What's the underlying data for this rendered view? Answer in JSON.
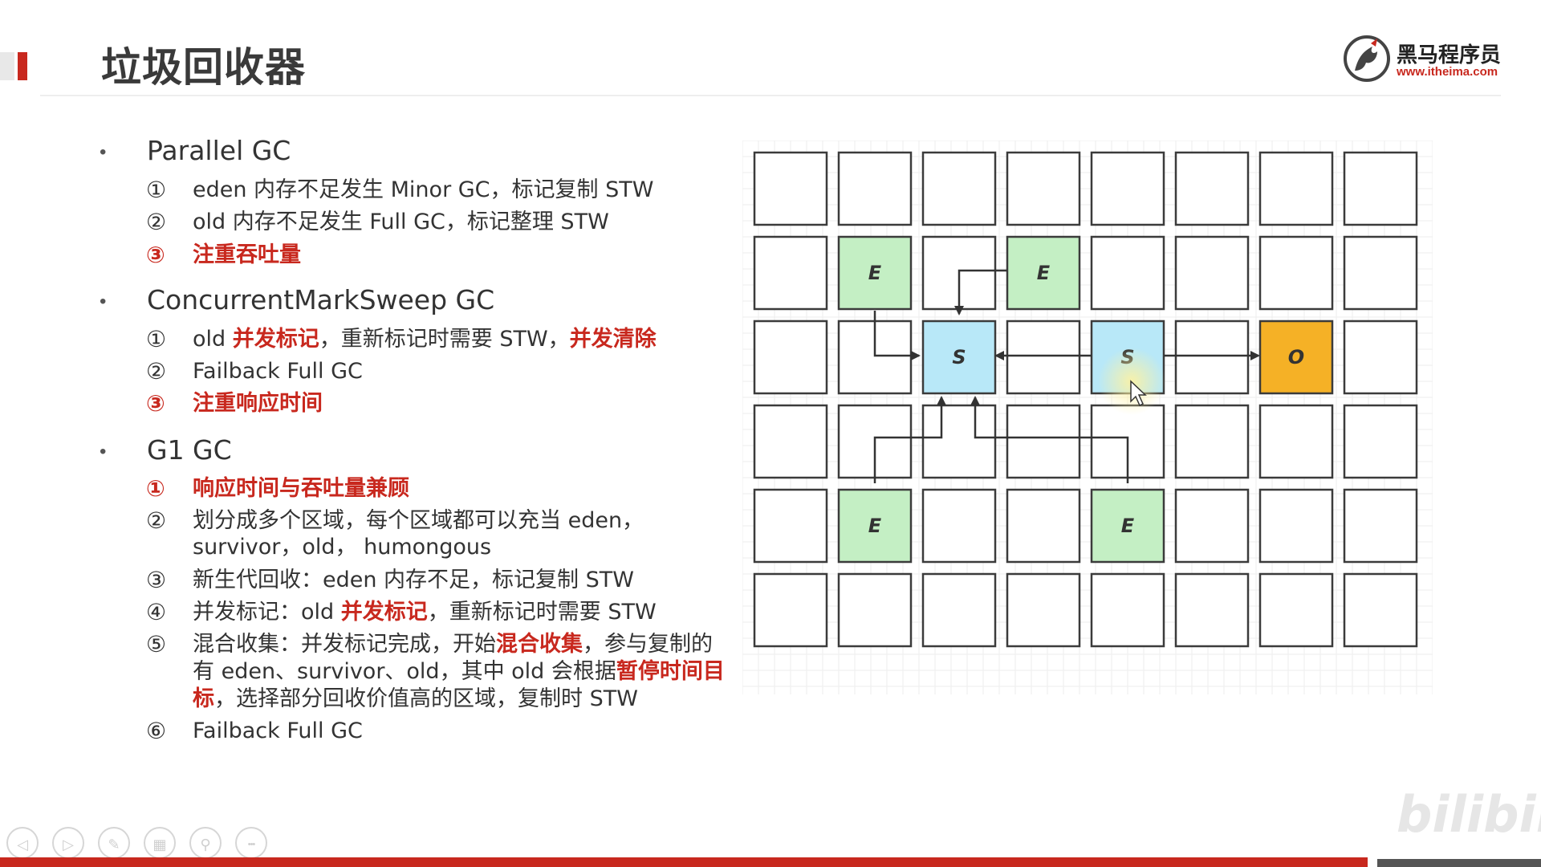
{
  "slide": {
    "title": "垃圾回收器",
    "logo": {
      "name": "黑马程序员",
      "url": "www.itheima.com"
    },
    "watermark": "bilibili"
  },
  "sections": [
    {
      "heading": "Parallel GC",
      "items": [
        {
          "num": "①",
          "text": "eden 内存不足发生 Minor GC，标记复制 STW"
        },
        {
          "num": "②",
          "text": "old 内存不足发生 Full GC，标记整理 STW"
        },
        {
          "num": "③",
          "text": "注重吞吐量"
        }
      ]
    },
    {
      "heading": "ConcurrentMarkSweep GC",
      "items": [
        {
          "num": "①",
          "parts": [
            "old ",
            "并发标记",
            "，重新标记时需要 STW，",
            "并发清除"
          ]
        },
        {
          "num": "②",
          "text": "Failback Full GC"
        },
        {
          "num": "③",
          "text": "注重响应时间"
        }
      ]
    },
    {
      "heading": "G1 GC",
      "items": [
        {
          "num": "①",
          "text": "响应时间与吞吐量兼顾"
        },
        {
          "num": "②",
          "lines": [
            "划分成多个区域，每个区域都可以充当 eden，",
            "survivor，old， humongous"
          ]
        },
        {
          "num": "③",
          "text": "新生代回收：eden 内存不足，标记复制 STW"
        },
        {
          "num": "④",
          "parts": [
            "并发标记：old ",
            "并发标记",
            "，重新标记时需要 STW"
          ]
        },
        {
          "num": "⑤",
          "line1": [
            "混合收集：并发标记完成，开始",
            "混合收集",
            "，参与复制的"
          ],
          "line2": [
            "有 eden、survivor、old，其中 old 会根据",
            "暂停时间目"
          ],
          "line3": [
            "标",
            "，选择部分回收价值高的区域，复制时 STW"
          ]
        },
        {
          "num": "⑥",
          "text": "Failback Full GC"
        }
      ]
    }
  ],
  "diagram": {
    "rows": 6,
    "cols": 8,
    "colors": {
      "E": "#c4efc4",
      "S": "#b8e8f8",
      "O": "#f5b126",
      "empty": "#ffffff",
      "border": "#3b3b3b",
      "grid": "#eeeeee"
    },
    "regions": [
      {
        "row": 1,
        "col": 1,
        "type": "E",
        "label": "E"
      },
      {
        "row": 1,
        "col": 3,
        "type": "E",
        "label": "E"
      },
      {
        "row": 2,
        "col": 2,
        "type": "S",
        "label": "S"
      },
      {
        "row": 2,
        "col": 4,
        "type": "S",
        "label": "S"
      },
      {
        "row": 2,
        "col": 6,
        "type": "O",
        "label": "O"
      },
      {
        "row": 4,
        "col": 1,
        "type": "E",
        "label": "E"
      },
      {
        "row": 4,
        "col": 4,
        "type": "E",
        "label": "E"
      }
    ]
  },
  "toolbar": [
    {
      "name": "previous-slide-button",
      "glyph": "◁"
    },
    {
      "name": "next-slide-button",
      "glyph": "▷"
    },
    {
      "name": "pen-tool-button",
      "glyph": "✎"
    },
    {
      "name": "slide-grid-button",
      "glyph": "▦"
    },
    {
      "name": "zoom-button",
      "glyph": "⚲"
    },
    {
      "name": "more-options-button",
      "glyph": "•••"
    }
  ]
}
